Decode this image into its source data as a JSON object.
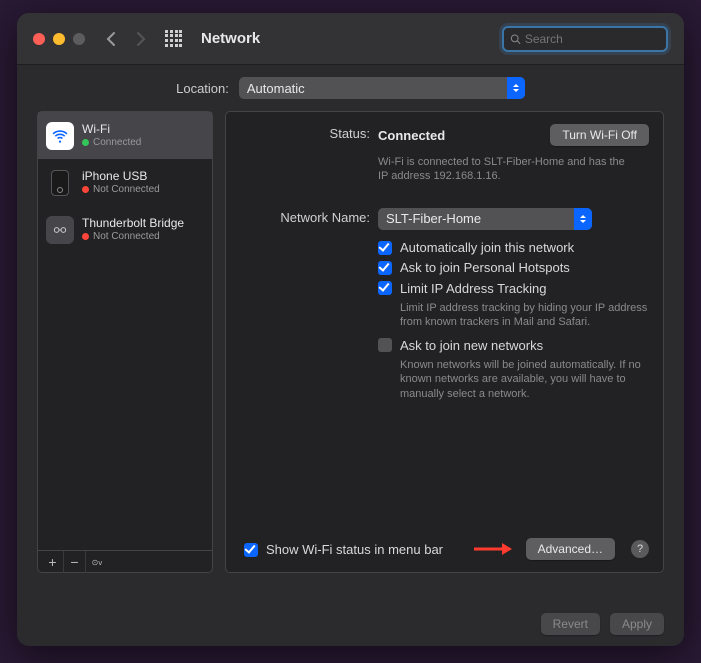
{
  "window": {
    "title": "Network",
    "search_placeholder": "Search"
  },
  "location": {
    "label": "Location:",
    "value": "Automatic"
  },
  "sidebar": {
    "items": [
      {
        "name": "Wi-Fi",
        "status": "Connected",
        "status_color": "green",
        "icon": "wifi",
        "selected": true
      },
      {
        "name": "iPhone USB",
        "status": "Not Connected",
        "status_color": "red",
        "icon": "iphone",
        "selected": false
      },
      {
        "name": "Thunderbolt Bridge",
        "status": "Not Connected",
        "status_color": "red",
        "icon": "thunderbolt",
        "selected": false
      }
    ],
    "footer": {
      "add": "+",
      "remove": "−",
      "menu": "⋯"
    }
  },
  "main": {
    "status_label": "Status:",
    "status_value": "Connected",
    "turn_off": "Turn Wi-Fi Off",
    "status_desc": "Wi-Fi is connected to SLT-Fiber-Home and has the IP address 192.168.1.16.",
    "netname_label": "Network Name:",
    "netname_value": "SLT-Fiber-Home",
    "auto_join": "Automatically join this network",
    "ask_hotspot": "Ask to join Personal Hotspots",
    "limit_ip": "Limit IP Address Tracking",
    "limit_ip_desc": "Limit IP address tracking by hiding your IP address from known trackers in Mail and Safari.",
    "ask_new": "Ask to join new networks",
    "ask_new_desc": "Known networks will be joined automatically. If no known networks are available, you will have to manually select a network.",
    "show_status": "Show Wi-Fi status in menu bar",
    "advanced": "Advanced…",
    "help": "?"
  },
  "footer": {
    "revert": "Revert",
    "apply": "Apply"
  }
}
